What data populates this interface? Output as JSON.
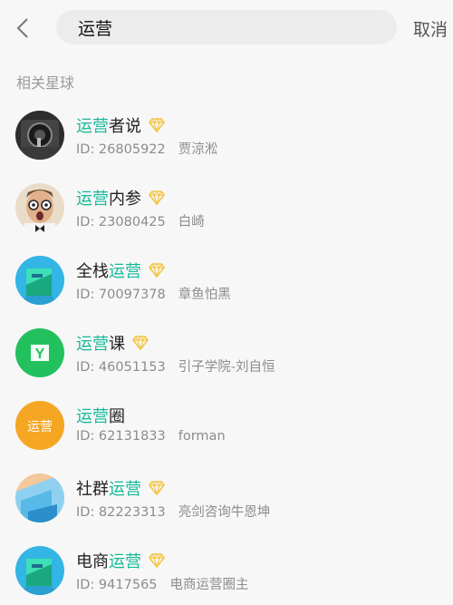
{
  "search": {
    "value": "运营",
    "cancel_label": "取消"
  },
  "section_label": "相关星球",
  "colors": {
    "highlight": "#16b998",
    "diamond": "#f2c544"
  },
  "items": [
    {
      "avatar": "camera-lens-avatar",
      "name_pre": "",
      "name_hl": "运营",
      "name_post": "者说",
      "vip": true,
      "id": "ID:  26805922",
      "owner": "贾涼淞"
    },
    {
      "avatar": "surprised-man-avatar",
      "name_pre": "",
      "name_hl": "运营",
      "name_post": "内参",
      "vip": true,
      "id": "ID:  23080425",
      "owner": "白崎"
    },
    {
      "avatar": "teal-square-avatar",
      "name_pre": "全栈",
      "name_hl": "运营",
      "name_post": "",
      "vip": true,
      "id": "ID:  70097378",
      "owner": "章鱼怕黑"
    },
    {
      "avatar": "green-y-avatar",
      "name_pre": "",
      "name_hl": "运营",
      "name_post": "课",
      "vip": true,
      "id": "ID:  46051153",
      "owner": "引子学院-刘自恒"
    },
    {
      "avatar": "yellow-text-avatar",
      "avatar_text": "运营",
      "name_pre": "",
      "name_hl": "运营",
      "name_post": "圈",
      "vip": false,
      "id": "ID:  62131833",
      "owner": "forman"
    },
    {
      "avatar": "landscape-avatar",
      "name_pre": "社群",
      "name_hl": "运营",
      "name_post": "",
      "vip": true,
      "id": "ID:  82223313",
      "owner": "亮剑咨询牛恩坤"
    },
    {
      "avatar": "teal-square-avatar",
      "name_pre": "电商",
      "name_hl": "运营",
      "name_post": "",
      "vip": true,
      "id": "ID:  9417565",
      "owner": "电商运营圈主"
    }
  ]
}
